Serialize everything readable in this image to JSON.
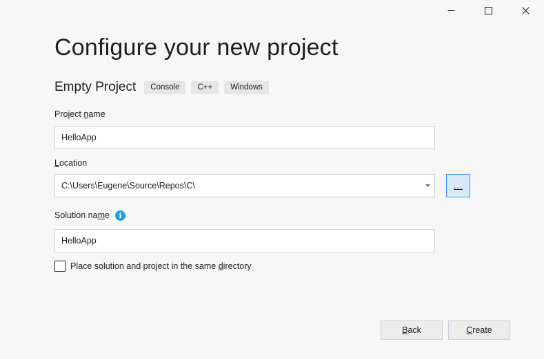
{
  "window": {
    "controls": [
      {
        "name": "minimize",
        "icon": "minimize-icon"
      },
      {
        "name": "maximize",
        "icon": "maximize-icon"
      },
      {
        "name": "close",
        "icon": "close-icon"
      }
    ]
  },
  "header": {
    "title": "Configure your new project"
  },
  "template": {
    "name": "Empty Project",
    "tags": [
      "Console",
      "C++",
      "Windows"
    ]
  },
  "form": {
    "project_name": {
      "label_pre": "Project ",
      "label_access": "n",
      "label_post": "ame",
      "value": "HelloApp"
    },
    "location": {
      "label_pre": "",
      "label_access": "L",
      "label_post": "ocation",
      "value": "C:\\Users\\Eugene\\Source\\Repos\\C\\",
      "browse_label": "..."
    },
    "solution_name": {
      "label_pre": "Solution na",
      "label_access": "m",
      "label_post": "e",
      "value": "HelloApp",
      "info_icon": "info-icon"
    },
    "same_directory": {
      "label_pre": "Place solution and project in the same ",
      "label_access": "d",
      "label_post": "irectory",
      "checked": false
    }
  },
  "footer": {
    "back": {
      "access": "B",
      "rest": "ack"
    },
    "create": {
      "access": "C",
      "rest": "reate"
    }
  },
  "colors": {
    "background": "#f7f7f8",
    "accent_border": "#3399ff",
    "info": "#1ba1e2"
  }
}
